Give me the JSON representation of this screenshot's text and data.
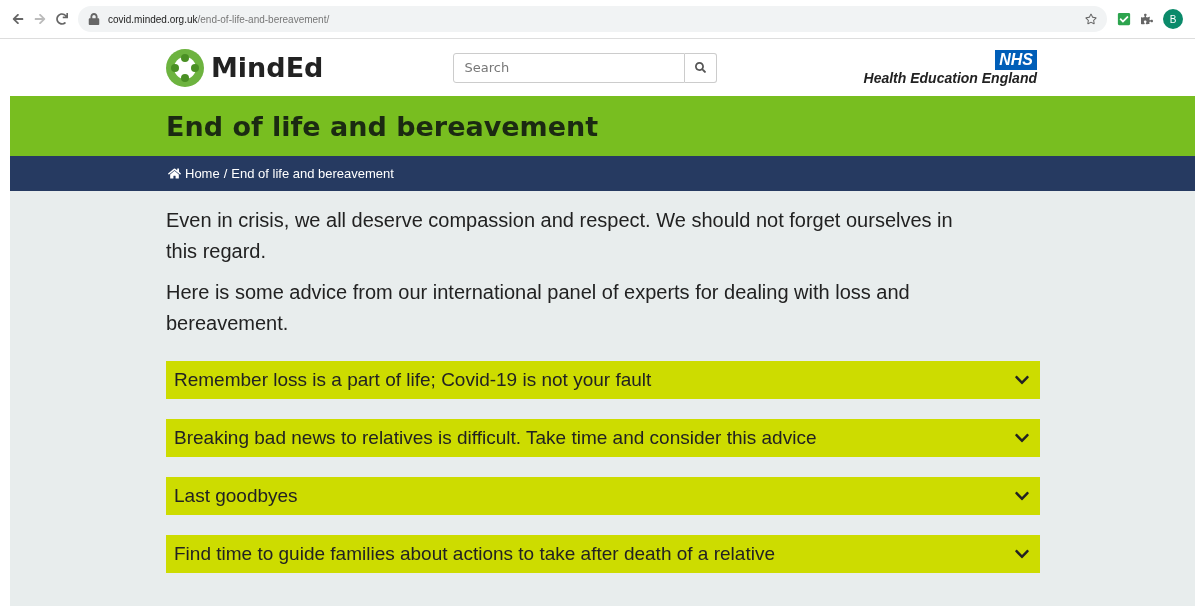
{
  "browser": {
    "url_host": "covid.minded.org.uk",
    "url_path": "/end-of-life-and-bereavement/",
    "profile_initial": "B"
  },
  "header": {
    "logo_text": "MindEd",
    "search": {
      "placeholder": "Search"
    },
    "nhs_badge": "NHS",
    "nhs_org": "Health Education England"
  },
  "page_title": "End of life and bereavement",
  "breadcrumb": {
    "home": "Home",
    "separator": "/",
    "current": "End of life and bereavement"
  },
  "intro": [
    "Even in crisis, we all deserve compassion and respect. We should not forget ourselves in this regard.",
    "Here is some advice from our international panel of experts for dealing with loss and bereavement."
  ],
  "accordion": [
    {
      "title": "Remember loss is a part of life; Covid-19 is not your fault",
      "expanded": false
    },
    {
      "title": "Breaking bad news to relatives is difficult. Take time and consider this advice",
      "expanded": false
    },
    {
      "title": "Last goodbyes",
      "expanded": false
    },
    {
      "title": "Find time to guide families about actions to take after death of a relative",
      "expanded": false
    }
  ]
}
